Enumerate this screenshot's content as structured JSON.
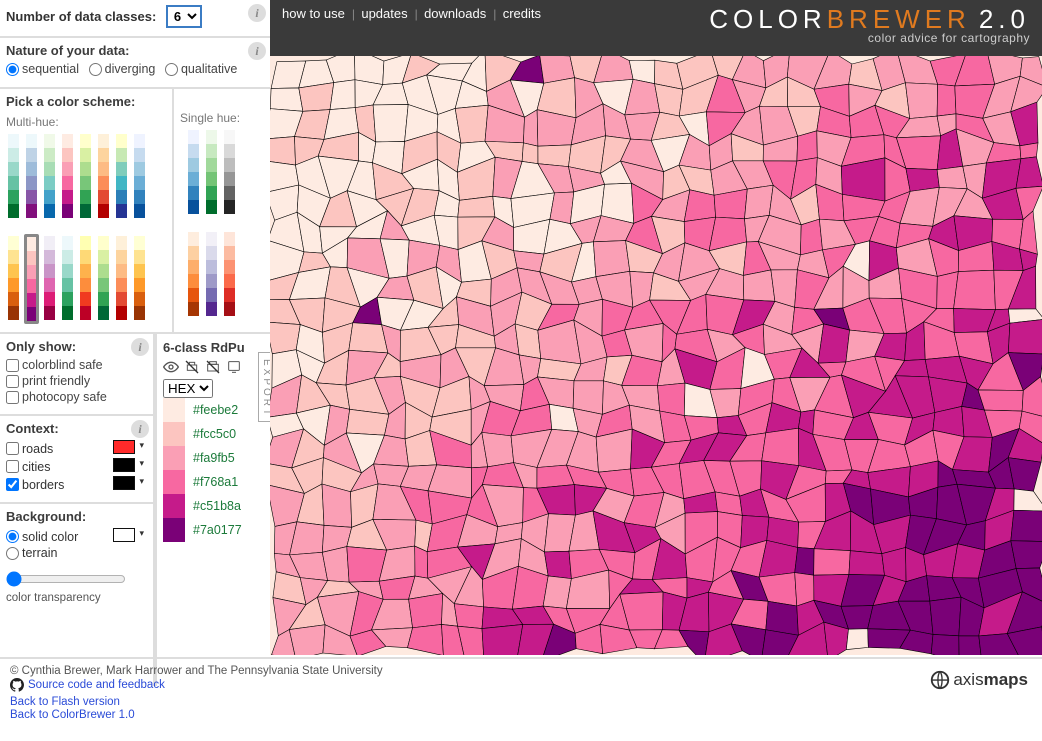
{
  "top": {
    "num_classes_label": "Number of data classes:",
    "num_classes_value": "6",
    "nature_label": "Nature of your data:",
    "nature_options": [
      "sequential",
      "diverging",
      "qualitative"
    ],
    "nature_selected": "sequential",
    "pick_label": "Pick a color scheme:",
    "multi_label": "Multi-hue:",
    "single_label": "Single hue:"
  },
  "schemes_multi_row1": [
    [
      "#edf8fb",
      "#ccece6",
      "#99d8c9",
      "#66c2a4",
      "#2ca25f",
      "#006d2c"
    ],
    [
      "#edf8fb",
      "#bfd3e6",
      "#9ebcda",
      "#8c96c6",
      "#8856a7",
      "#810f7c"
    ],
    [
      "#f0f9e8",
      "#ccebc5",
      "#a8ddb5",
      "#7bccc4",
      "#43a2ca",
      "#0868ac"
    ],
    [
      "#feebe2",
      "#fcc5c0",
      "#fa9fb5",
      "#f768a1",
      "#c51b8a",
      "#7a0177"
    ],
    [
      "#ffffcc",
      "#d9f0a3",
      "#addd8e",
      "#78c679",
      "#31a354",
      "#006837"
    ],
    [
      "#fef0d9",
      "#fdd49e",
      "#fdbb84",
      "#fc8d59",
      "#e34a33",
      "#b30000"
    ],
    [
      "#ffffcc",
      "#c7e9b4",
      "#7fcdbb",
      "#41b6c4",
      "#2c7fb8",
      "#253494"
    ],
    [
      "#eff3ff",
      "#c6dbef",
      "#9ecae1",
      "#6baed6",
      "#3182bd",
      "#08519c"
    ]
  ],
  "schemes_multi_row2": [
    [
      "#ffffd4",
      "#fee391",
      "#fec44f",
      "#fe9929",
      "#d95f0e",
      "#993404"
    ],
    [
      "#feebe2",
      "#fcc5c0",
      "#fa9fb5",
      "#f768a1",
      "#c51b8a",
      "#7a0177"
    ],
    [
      "#f1eef6",
      "#d4b9da",
      "#c994c7",
      "#df65b0",
      "#dd1c77",
      "#980043"
    ],
    [
      "#edf8fb",
      "#ccece6",
      "#99d8c9",
      "#66c2a4",
      "#2ca25f",
      "#006d2c"
    ],
    [
      "#ffffb2",
      "#fed976",
      "#feb24c",
      "#fd8d3c",
      "#f03b20",
      "#bd0026"
    ],
    [
      "#ffffcc",
      "#d9f0a3",
      "#addd8e",
      "#78c679",
      "#31a354",
      "#006837"
    ],
    [
      "#fef0d9",
      "#fdd49e",
      "#fdbb84",
      "#fc8d59",
      "#e34a33",
      "#b30000"
    ],
    [
      "#ffffd4",
      "#fee391",
      "#fec44f",
      "#fe9929",
      "#d95f0e",
      "#993404"
    ]
  ],
  "selected_multi_index": 1,
  "schemes_single": [
    [
      "#eff3ff",
      "#c6dbef",
      "#9ecae1",
      "#6baed6",
      "#3182bd",
      "#08519c"
    ],
    [
      "#edf8e9",
      "#c7e9c0",
      "#a1d99b",
      "#74c476",
      "#31a354",
      "#006d2c"
    ],
    [
      "#f7f7f7",
      "#d9d9d9",
      "#bdbdbd",
      "#969696",
      "#636363",
      "#252525"
    ]
  ],
  "schemes_single2": [
    [
      "#feedde",
      "#fdd0a2",
      "#fdae6b",
      "#fd8d3c",
      "#e6550d",
      "#a63603"
    ],
    [
      "#f2f0f7",
      "#dadaeb",
      "#bcbddc",
      "#9e9ac8",
      "#756bb1",
      "#54278f"
    ],
    [
      "#fee5d9",
      "#fcbba1",
      "#fc9272",
      "#fb6a4a",
      "#de2d26",
      "#a50f15"
    ]
  ],
  "filters": {
    "title": "Only show:",
    "opts": [
      "colorblind safe",
      "print friendly",
      "photocopy safe"
    ]
  },
  "context": {
    "title": "Context:",
    "roads": "roads",
    "cities": "cities",
    "borders": "borders",
    "borders_checked": true,
    "road_color": "#ff2a2a",
    "city_color": "#000000",
    "border_color": "#000000"
  },
  "background": {
    "title": "Background:",
    "opts": [
      "solid color",
      "terrain"
    ],
    "selected": "solid color",
    "swatch": "#ffffff",
    "slider_label": "color transparency"
  },
  "detail": {
    "title": "6-class RdPu",
    "format": "HEX",
    "export": "EXPORT",
    "colors": [
      {
        "hex": "#feebe2"
      },
      {
        "hex": "#fcc5c0"
      },
      {
        "hex": "#fa9fb5"
      },
      {
        "hex": "#f768a1"
      },
      {
        "hex": "#c51b8a"
      },
      {
        "hex": "#7a0177"
      }
    ]
  },
  "nav": {
    "how": "how to use",
    "updates": "updates",
    "downloads": "downloads",
    "credits": "credits"
  },
  "brand": {
    "p1": "COLOR",
    "p2": "BREWER",
    "p3": "2.0",
    "sub": "color advice for cartography"
  },
  "footer": {
    "copyright": "© Cynthia Brewer, Mark Harrower and The Pennsylvania State University",
    "src": "Source code and feedback",
    "flash": "Back to Flash version",
    "v1": "Back to ColorBrewer 1.0",
    "axis": "axismaps"
  }
}
